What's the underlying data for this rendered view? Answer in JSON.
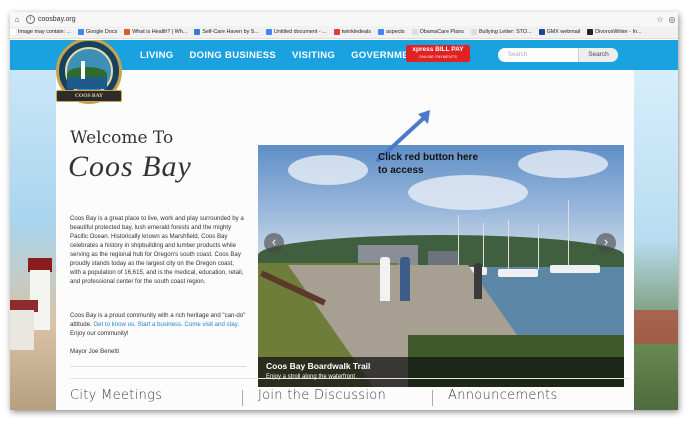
{
  "browser": {
    "url": "coosbay.org",
    "bookmarks": [
      {
        "label": "Image may contain: ...",
        "color": "#ffffff"
      },
      {
        "label": "Google Docs",
        "color": "#4285f4"
      },
      {
        "label": "What is Health? | Wh...",
        "color": "#e05a2b"
      },
      {
        "label": "Self-Care Haven by S...",
        "color": "#3a7bd5"
      },
      {
        "label": "Untitled document - ...",
        "color": "#4285f4"
      },
      {
        "label": "twinkledeals",
        "color": "#e03c3c"
      },
      {
        "label": "aspects",
        "color": "#4285f4"
      },
      {
        "label": "ObamaCare Plans",
        "color": "#dddddd"
      },
      {
        "label": "Bullying Letter: STO...",
        "color": "#dddddd"
      },
      {
        "label": "GMX webmail",
        "color": "#1c449b"
      },
      {
        "label": "DivorceWriter - In...",
        "color": "#222222"
      }
    ]
  },
  "site": {
    "logo_text": "COOS BAY",
    "nav": [
      "LIVING",
      "DOING BUSINESS",
      "VISITING",
      "GOVERNMENT"
    ],
    "xpress_title": "xpress BILL PAY",
    "xpress_sub": "ONLINE PAYMENTS",
    "search_placeholder": "Search",
    "search_button": "Search"
  },
  "welcome": {
    "title": "Welcome To",
    "city": "Coos Bay",
    "intro": "Coos Bay is a great place to live, work and play surrounded by a beautiful protected bay, lush emerald forests and the mighty Pacific Ocean. Historically known as Marshfield, Coos Bay celebrates a history in shipbuilding and lumber products while serving as the regional hub for Oregon's south coast. Coos Bay proudly stands today as the largest city on the Oregon coast, with a population of 16,615, and is the medical, education, retail, and professional center for the south coast region.",
    "intro2_prefix": "Coos Bay is a proud community with a rich heritage and \"can-do\" attitude.",
    "link1": "Get to know us.",
    "link2": "Start a business.",
    "link3": "Come visit and stay.",
    "intro2_suffix": "Enjoy our community!",
    "mayor": "Mayor Joe Benetti"
  },
  "slider": {
    "caption_title": "Coos Bay Boardwalk Trail",
    "caption_sub": "Enjoy a stroll along the waterfront"
  },
  "sections": [
    "City Meetings",
    "Join the Discussion",
    "Announcements"
  ],
  "annotation": "Click red button here to access",
  "colors": {
    "nav_blue": "#1aa1df",
    "xpress_red": "#e02222",
    "annotation_arrow": "#4a7bc8"
  }
}
